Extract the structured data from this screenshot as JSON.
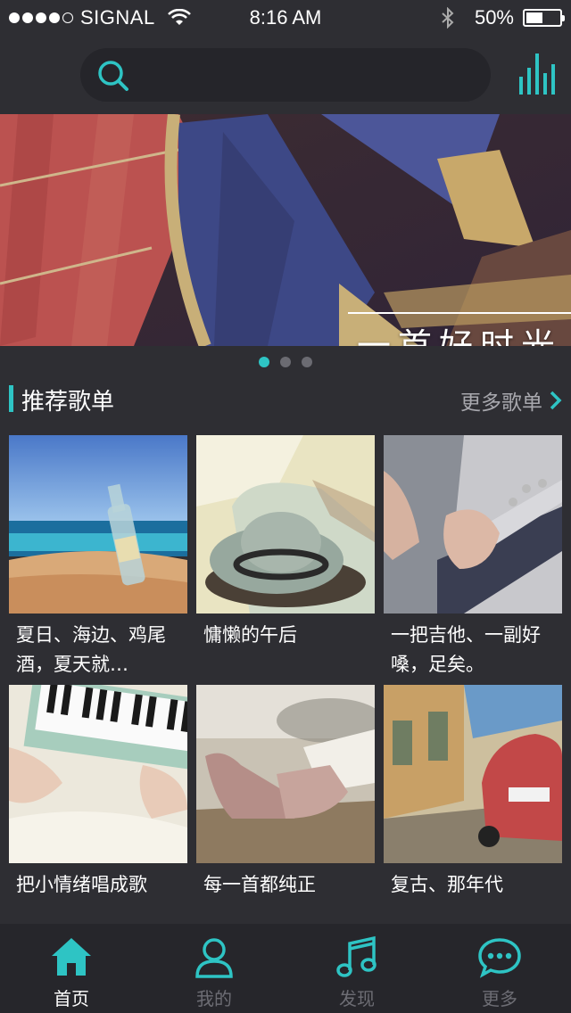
{
  "status_bar": {
    "carrier": "SIGNAL",
    "time": "8:16 AM",
    "battery": "50%",
    "signal_bars_filled": 4,
    "battery_level": 0.5
  },
  "search": {
    "placeholder": "",
    "icon": "search-icon"
  },
  "header": {
    "equalizer_icon": "equalizer-icon"
  },
  "banner": {
    "title": "一首好时光",
    "pages": 3,
    "active_page": 1
  },
  "recommended": {
    "title": "推荐歌单",
    "more_label": "更多歌单",
    "items": [
      {
        "caption": "夏日、海边、鸡尾酒，夏天就…"
      },
      {
        "caption": "慵懒的午后"
      },
      {
        "caption": "一把吉他、一副好嗓，足矣。"
      },
      {
        "caption": "把小情绪唱成歌"
      },
      {
        "caption": "每一首都纯正"
      },
      {
        "caption": "复古、那年代"
      }
    ]
  },
  "tabs": [
    {
      "label": "首页",
      "icon": "home-icon",
      "active": true
    },
    {
      "label": "我的",
      "icon": "user-icon",
      "active": false
    },
    {
      "label": "发现",
      "icon": "music-note-icon",
      "active": false
    },
    {
      "label": "更多",
      "icon": "more-chat-icon",
      "active": false
    }
  ],
  "colors": {
    "accent": "#2ec4c4",
    "background": "#2e2e33",
    "tab_bar": "#26262b",
    "inactive": "#6d6d74"
  }
}
